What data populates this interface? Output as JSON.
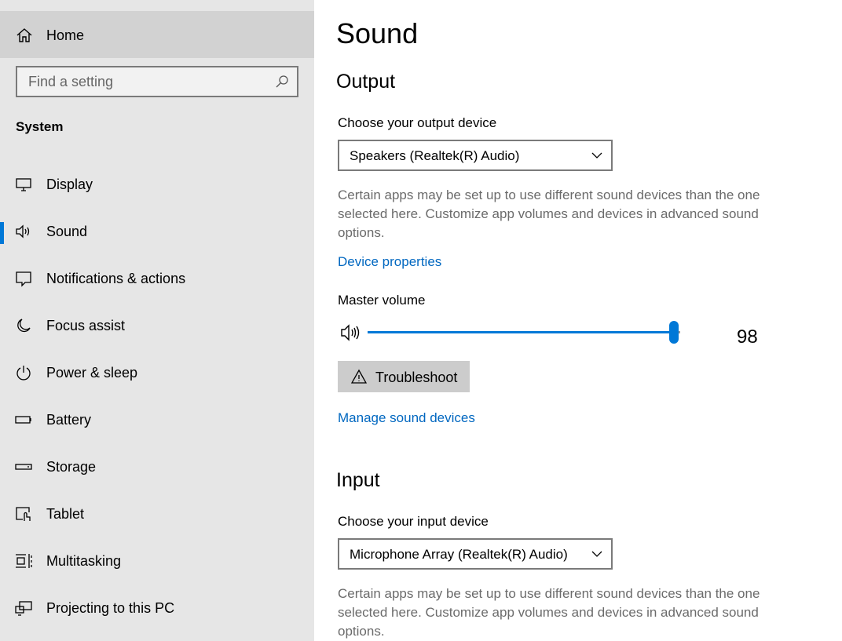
{
  "sidebar": {
    "home_label": "Home",
    "search_placeholder": "Find a setting",
    "section_title": "System",
    "items": [
      {
        "label": "Display",
        "icon": "monitor-icon"
      },
      {
        "label": "Sound",
        "icon": "speaker-icon",
        "selected": true
      },
      {
        "label": "Notifications & actions",
        "icon": "notification-icon"
      },
      {
        "label": "Focus assist",
        "icon": "moon-icon"
      },
      {
        "label": "Power & sleep",
        "icon": "power-icon"
      },
      {
        "label": "Battery",
        "icon": "battery-icon"
      },
      {
        "label": "Storage",
        "icon": "storage-icon"
      },
      {
        "label": "Tablet",
        "icon": "tablet-icon"
      },
      {
        "label": "Multitasking",
        "icon": "multitasking-icon"
      },
      {
        "label": "Projecting to this PC",
        "icon": "projecting-icon"
      }
    ]
  },
  "main": {
    "title": "Sound",
    "output": {
      "heading": "Output",
      "device_label": "Choose your output device",
      "device_value": "Speakers (Realtek(R) Audio)",
      "description": "Certain apps may be set up to use different sound devices than the one selected here. Customize app volumes and devices in advanced sound options.",
      "device_properties_link": "Device properties",
      "master_volume_label": "Master volume",
      "volume_value": "98",
      "troubleshoot_label": "Troubleshoot",
      "manage_devices_link": "Manage sound devices"
    },
    "input": {
      "heading": "Input",
      "device_label": "Choose your input device",
      "device_value": "Microphone Array (Realtek(R) Audio)",
      "description": "Certain apps may be set up to use different sound devices than the one selected here. Customize app volumes and devices in advanced sound options."
    }
  },
  "colors": {
    "accent": "#0078d7",
    "link": "#0067c0",
    "sidebar_bg": "#e6e6e6",
    "home_bg": "#d2d2d2"
  }
}
